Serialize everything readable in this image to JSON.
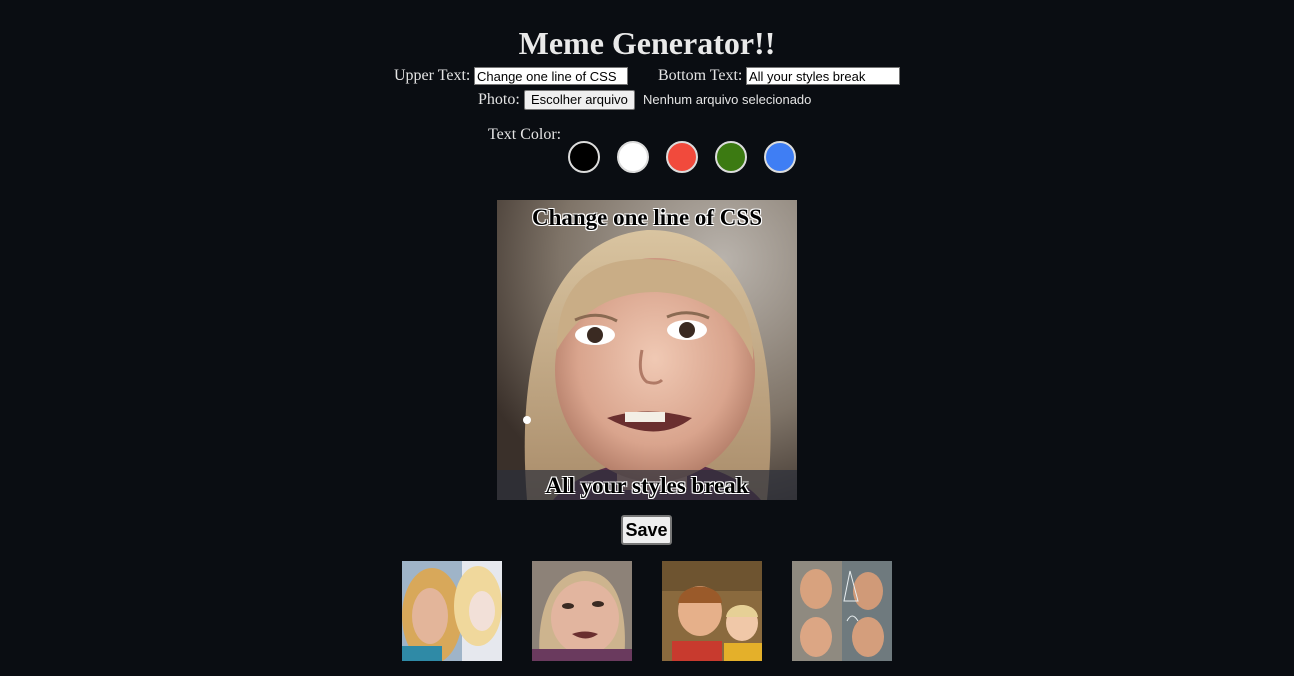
{
  "app": {
    "title": "Meme Generator!!"
  },
  "form": {
    "upper_label": "Upper Text:",
    "upper_value": "Change one line of CSS",
    "bottom_label": "Bottom Text:",
    "bottom_value": "All your styles break",
    "photo_label": "Photo:",
    "file_button_label": "Escolher arquivo",
    "file_status": "Nenhum arquivo selecionado",
    "color_label": "Text Color:"
  },
  "colors": [
    {
      "name": "black",
      "hex": "#000000"
    },
    {
      "name": "white",
      "hex": "#ffffff"
    },
    {
      "name": "red",
      "hex": "#f14a3c"
    },
    {
      "name": "green",
      "hex": "#3c7a12"
    },
    {
      "name": "blue",
      "hex": "#3f7ef4"
    }
  ],
  "meme": {
    "upper_text": "Change one line of CSS",
    "bottom_text": "All your styles break",
    "text_color": "#000000",
    "image": "side-eye-girl"
  },
  "actions": {
    "save_label": "Save"
  },
  "gallery": [
    {
      "image": "blonde-woman-crying"
    },
    {
      "image": "side-eye-girl"
    },
    {
      "image": "confused-kids"
    },
    {
      "image": "confused-math-lady"
    }
  ]
}
